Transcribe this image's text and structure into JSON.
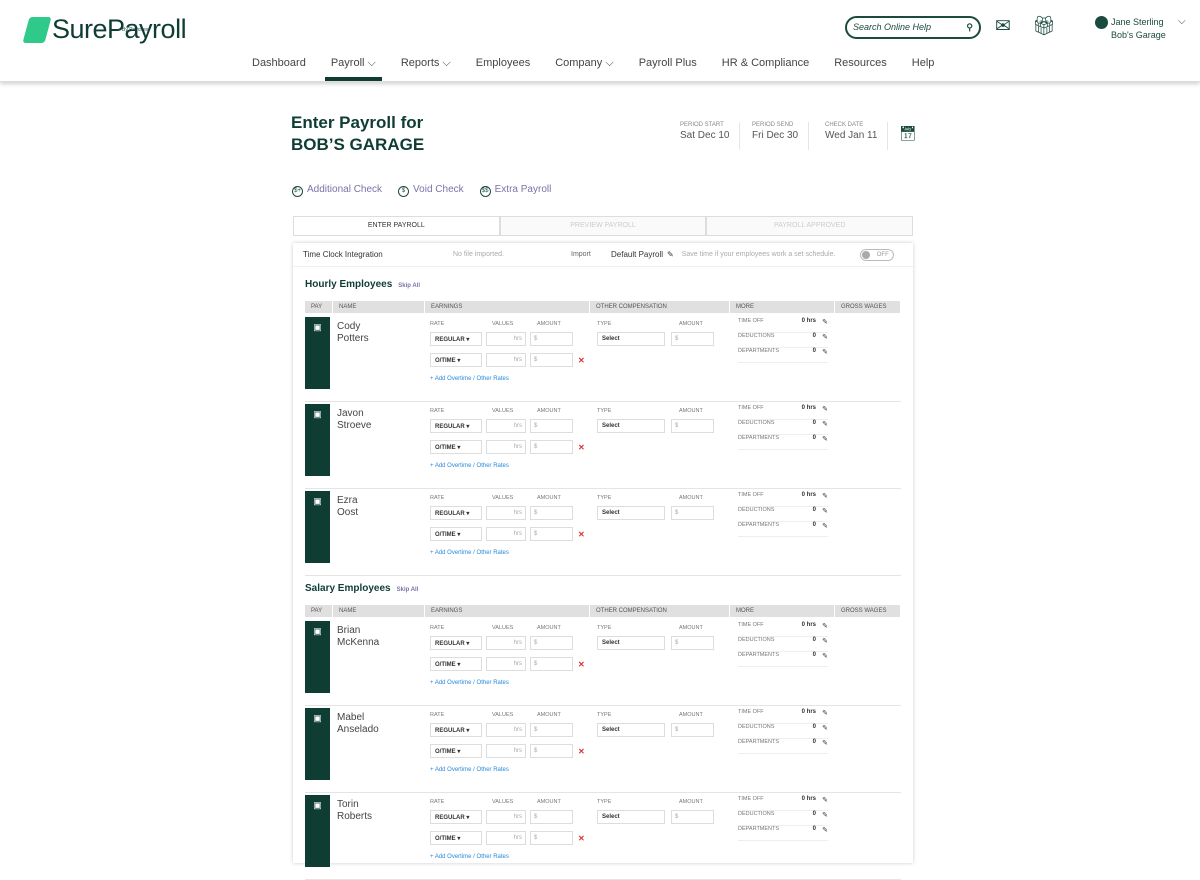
{
  "brand": {
    "name": "SurePayroll",
    "sub": "By Paychex"
  },
  "header": {
    "search_placeholder": "Search Online Help",
    "user_name": "Jane Sterling",
    "company": "Bob's Garage"
  },
  "nav": [
    "Dashboard",
    "Payroll ⌵",
    "Reports ⌵",
    "Employees",
    "Company ⌵",
    "Payroll Plus",
    "HR & Compliance",
    "Resources",
    "Help"
  ],
  "page": {
    "title1": "Enter Payroll for",
    "title2": "BOB’S GARAGE",
    "periods": [
      {
        "label": "PERIOD START",
        "value": "Sat Dec 10"
      },
      {
        "label": "PERIOD SEND",
        "value": "Fri Dec 30"
      },
      {
        "label": "CHECK DATE",
        "value": "Wed Jan 11"
      }
    ],
    "links": [
      {
        "icon": "$+",
        "label": "Additional Check"
      },
      {
        "icon": "$",
        "label": "Void Check"
      },
      {
        "icon": "$$",
        "label": "Extra Payroll"
      }
    ],
    "steps": [
      "ENTER PAYROLL",
      "PREVIEW PAYROLL",
      "PAYROLL APPROVED"
    ]
  },
  "timeclock": {
    "label": "Time Clock Integration",
    "status": "No file imported.",
    "import": "Import",
    "default": "Default Payroll",
    "hint": "Save time if your employees work a set schedule.",
    "toggle": "OFF"
  },
  "columns": [
    "PAY",
    "NAME",
    "EARNINGS",
    "OTHER COMPENSATION",
    "MORE",
    "GROSS WAGES"
  ],
  "labels": {
    "rate": "RATE",
    "values": "VALUES",
    "amount": "AMOUNT",
    "type": "TYPE",
    "regular": "REGULAR ▾",
    "otime": "O/TIME ▾",
    "hrs": "hrs",
    "dollar": "$",
    "select": "Select",
    "add": "+ Add Overtime / Other Rates",
    "time_off": "TIME OFF",
    "deductions": "DEDUCTIONS",
    "departments": "DEPARTMENTS",
    "zero_hrs": "0 hrs",
    "zero": "0",
    "skip": "Skip All"
  },
  "sections": [
    {
      "title": "Hourly Employees",
      "employees": [
        [
          "Cody",
          "Potters"
        ],
        [
          "Javon",
          "Stroeve"
        ],
        [
          "Ezra",
          "Oost"
        ]
      ]
    },
    {
      "title": "Salary Employees",
      "employees": [
        [
          "Brian",
          "McKenna"
        ],
        [
          "Mabel",
          "Anselado"
        ],
        [
          "Torin",
          "Roberts"
        ]
      ]
    }
  ]
}
